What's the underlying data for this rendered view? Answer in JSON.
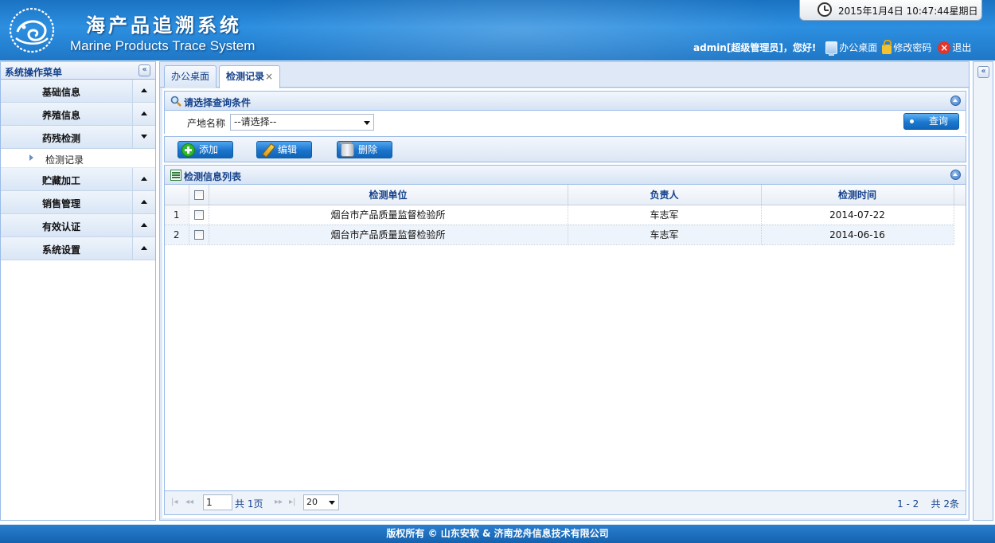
{
  "header": {
    "title_cn": "海产品追溯系统",
    "title_en": "Marine Products Trace System",
    "clock": "2015年1月4日  10:47:44星期日",
    "user": "admin[超级管理员]，您好!",
    "links": {
      "desktop": "办公桌面",
      "change_password": "修改密码",
      "logout": "退出"
    }
  },
  "sidebar": {
    "title": "系统操作菜单",
    "collapse": "«",
    "items": [
      {
        "label": "基础信息"
      },
      {
        "label": "养殖信息"
      },
      {
        "label": "药残检测",
        "expanded": true,
        "children": [
          {
            "label": "检测记录"
          }
        ]
      },
      {
        "label": "贮藏加工"
      },
      {
        "label": "销售管理"
      },
      {
        "label": "有效认证"
      },
      {
        "label": "系统设置"
      }
    ]
  },
  "right_strip": {
    "collapse": "«"
  },
  "tabs": [
    {
      "label": "办公桌面"
    },
    {
      "label": "检测记录",
      "close": "×",
      "active": true
    }
  ],
  "query": {
    "title": "请选择查询条件",
    "field_label": "产地名称",
    "select_value": "--请选择--",
    "search_button": "查询"
  },
  "toolbar": {
    "add": "添加",
    "edit": "编辑",
    "delete": "删除"
  },
  "grid": {
    "title": "检测信息列表",
    "columns": [
      "检测单位",
      "负责人",
      "检测时间"
    ],
    "rows": [
      {
        "num": "1",
        "unit": "烟台市产品质量监督检验所",
        "person": "车志军",
        "date": "2014-07-22"
      },
      {
        "num": "2",
        "unit": "烟台市产品质量监督检验所",
        "person": "车志军",
        "date": "2014-06-16"
      }
    ]
  },
  "pager": {
    "page": "1",
    "of_label": "共",
    "page_total": "1页",
    "page_size": "20",
    "info": "1 - 2    共 2条"
  },
  "footer": "版权所有 © 山东安软 & 济南龙舟信息技术有限公司",
  "colors": {
    "header_blue": "#1f77c6",
    "border": "#99bbe8",
    "panel_title": "#15428b"
  }
}
